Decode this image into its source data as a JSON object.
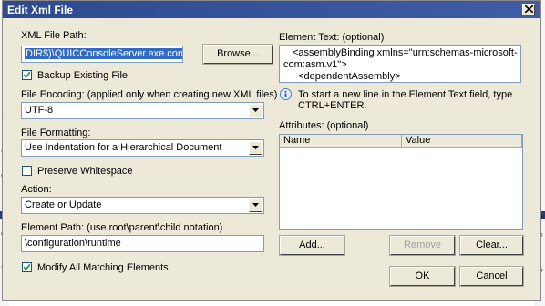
{
  "background": {
    "left_fragments": [
      "1",
      "s",
      "t",
      "C",
      "C",
      "v",
      "C",
      "C",
      "v"
    ],
    "right_fragments": [
      "f",
      "f",
      "f"
    ]
  },
  "dialog": {
    "title": "Edit Xml File",
    "close_icon": "close-x-icon"
  },
  "left": {
    "xml_file_path_label": "XML File Path:",
    "xml_file_path_value": "DIR$)\\QUICConsoleServer.exe.config",
    "browse_button": "Browse...",
    "backup_checkbox_label": "Backup Existing File",
    "backup_checked": true,
    "file_encoding_label": "File Encoding: (applied only when creating new XML files)",
    "file_encoding_value": "UTF-8",
    "file_formatting_label": "File Formatting:",
    "file_formatting_value": "Use Indentation for a Hierarchical Document",
    "preserve_whitespace_label": "Preserve Whitespace",
    "preserve_whitespace_checked": false,
    "action_label": "Action:",
    "action_value": "Create or Update",
    "element_path_label": "Element Path: (use root\\parent\\child notation)",
    "element_path_value": "\\configuration\\runtime",
    "modify_all_label": "Modify All Matching Elements",
    "modify_all_checked": true
  },
  "right": {
    "element_text_label": "Element Text: (optional)",
    "element_text_lines": [
      "<assemblyBinding xmlns=\"urn:schemas-microsoft-",
      "com:asm.v1\">",
      "  <dependentAssembly>"
    ],
    "info_text_line1": "To start a new line in the Element Text field, type",
    "info_text_line2": "CTRL+ENTER.",
    "attributes_label": "Attributes: (optional)",
    "attributes_columns": [
      "Name",
      "Value"
    ],
    "add_button": "Add...",
    "remove_button": "Remove",
    "clear_button": "Clear...",
    "ok_button": "OK",
    "cancel_button": "Cancel"
  },
  "colors": {
    "title_bar": "#2d4a8c",
    "selection": "#316ac5",
    "dialog_face": "#ece9d8"
  }
}
